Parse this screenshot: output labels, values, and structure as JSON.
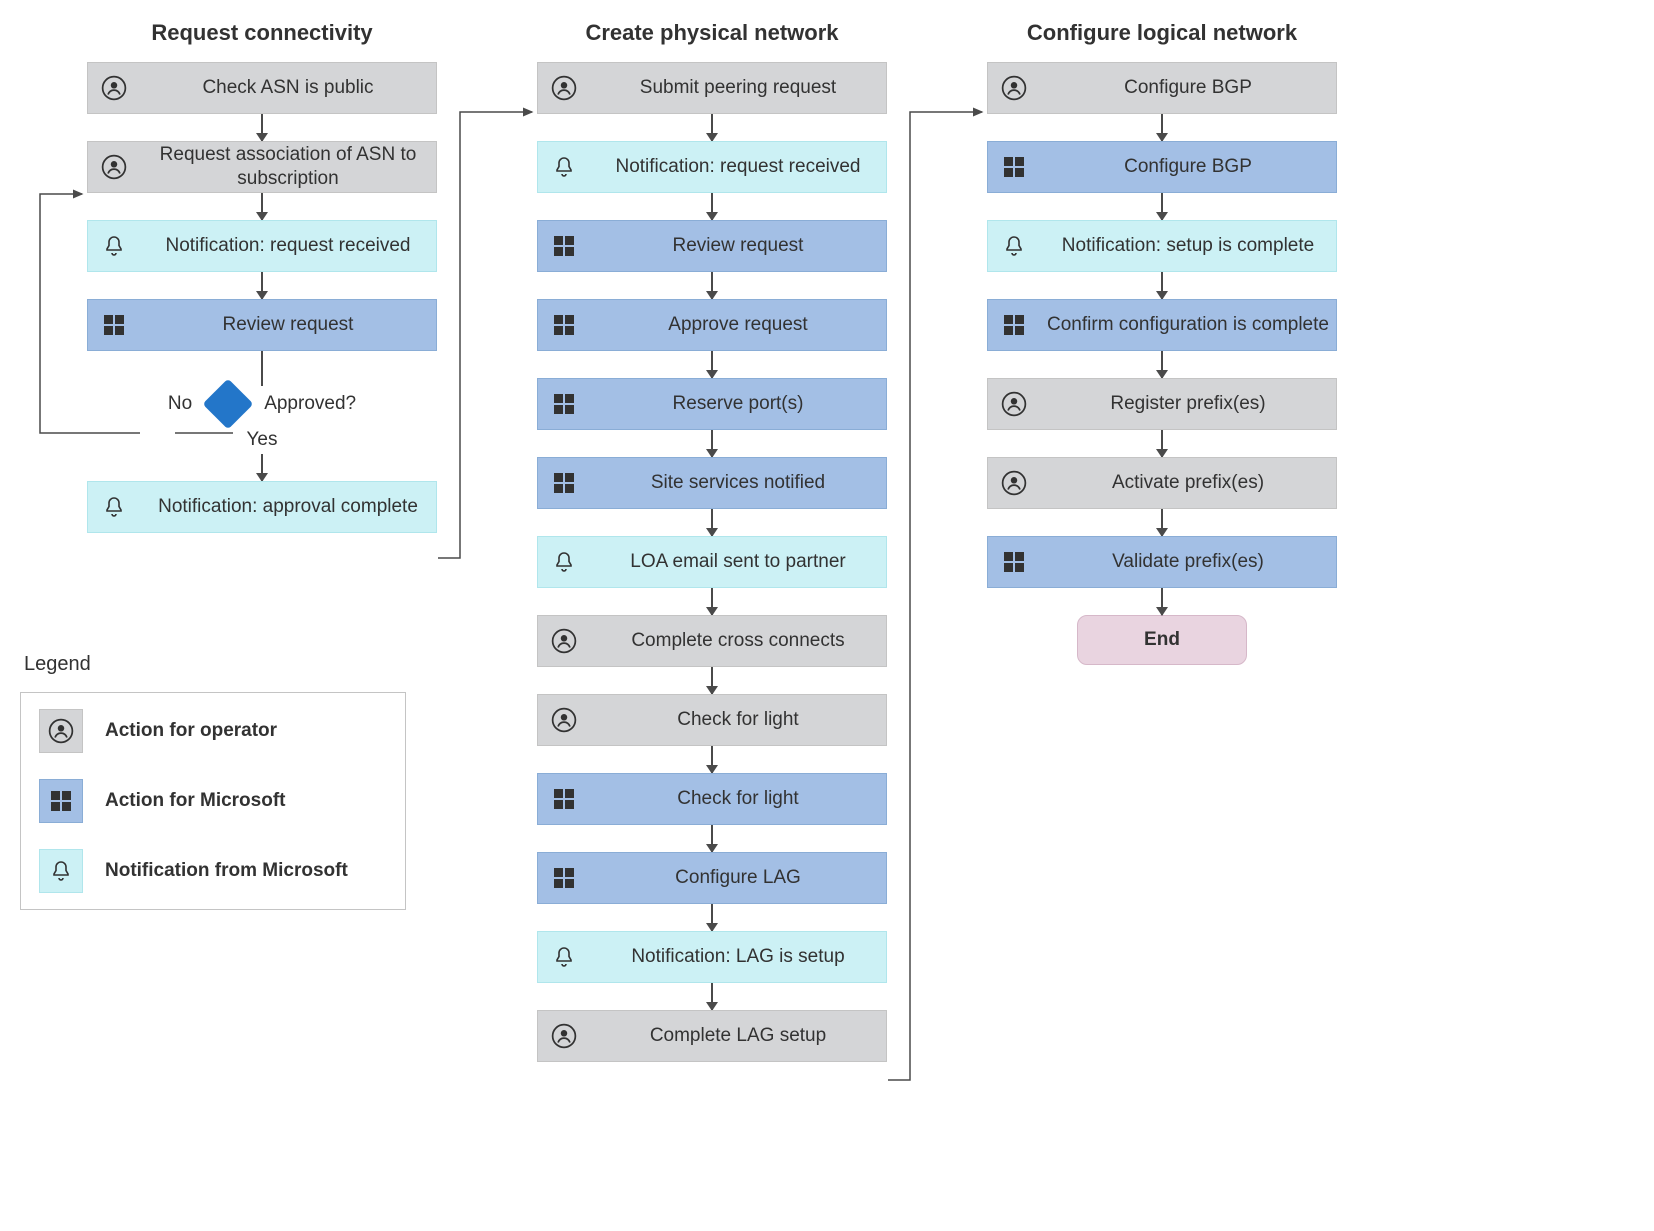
{
  "columns": {
    "col1": {
      "title": "Request connectivity",
      "steps": [
        "Check ASN is public",
        "Request association of ASN to subscription",
        "Notification: request received",
        "Review request",
        "Notification: approval complete"
      ]
    },
    "col2": {
      "title": "Create physical network",
      "steps": [
        "Submit peering request",
        "Notification: request received",
        "Review request",
        "Approve request",
        "Reserve port(s)",
        "Site services notified",
        "LOA email sent to partner",
        "Complete cross connects",
        "Check for light",
        "Check for light",
        "Configure LAG",
        "Notification: LAG is setup",
        "Complete LAG setup"
      ]
    },
    "col3": {
      "title": "Configure logical network",
      "steps": [
        "Configure BGP",
        "Configure BGP",
        "Notification: setup is complete",
        "Confirm configuration is complete",
        "Register prefix(es)",
        "Activate prefix(es)",
        "Validate prefix(es)"
      ]
    }
  },
  "decision": {
    "no": "No",
    "yes": "Yes",
    "question": "Approved?"
  },
  "end": "End",
  "legend": {
    "title": "Legend",
    "operator": "Action for operator",
    "microsoft": "Action for Microsoft",
    "notification": "Notification from Microsoft"
  }
}
